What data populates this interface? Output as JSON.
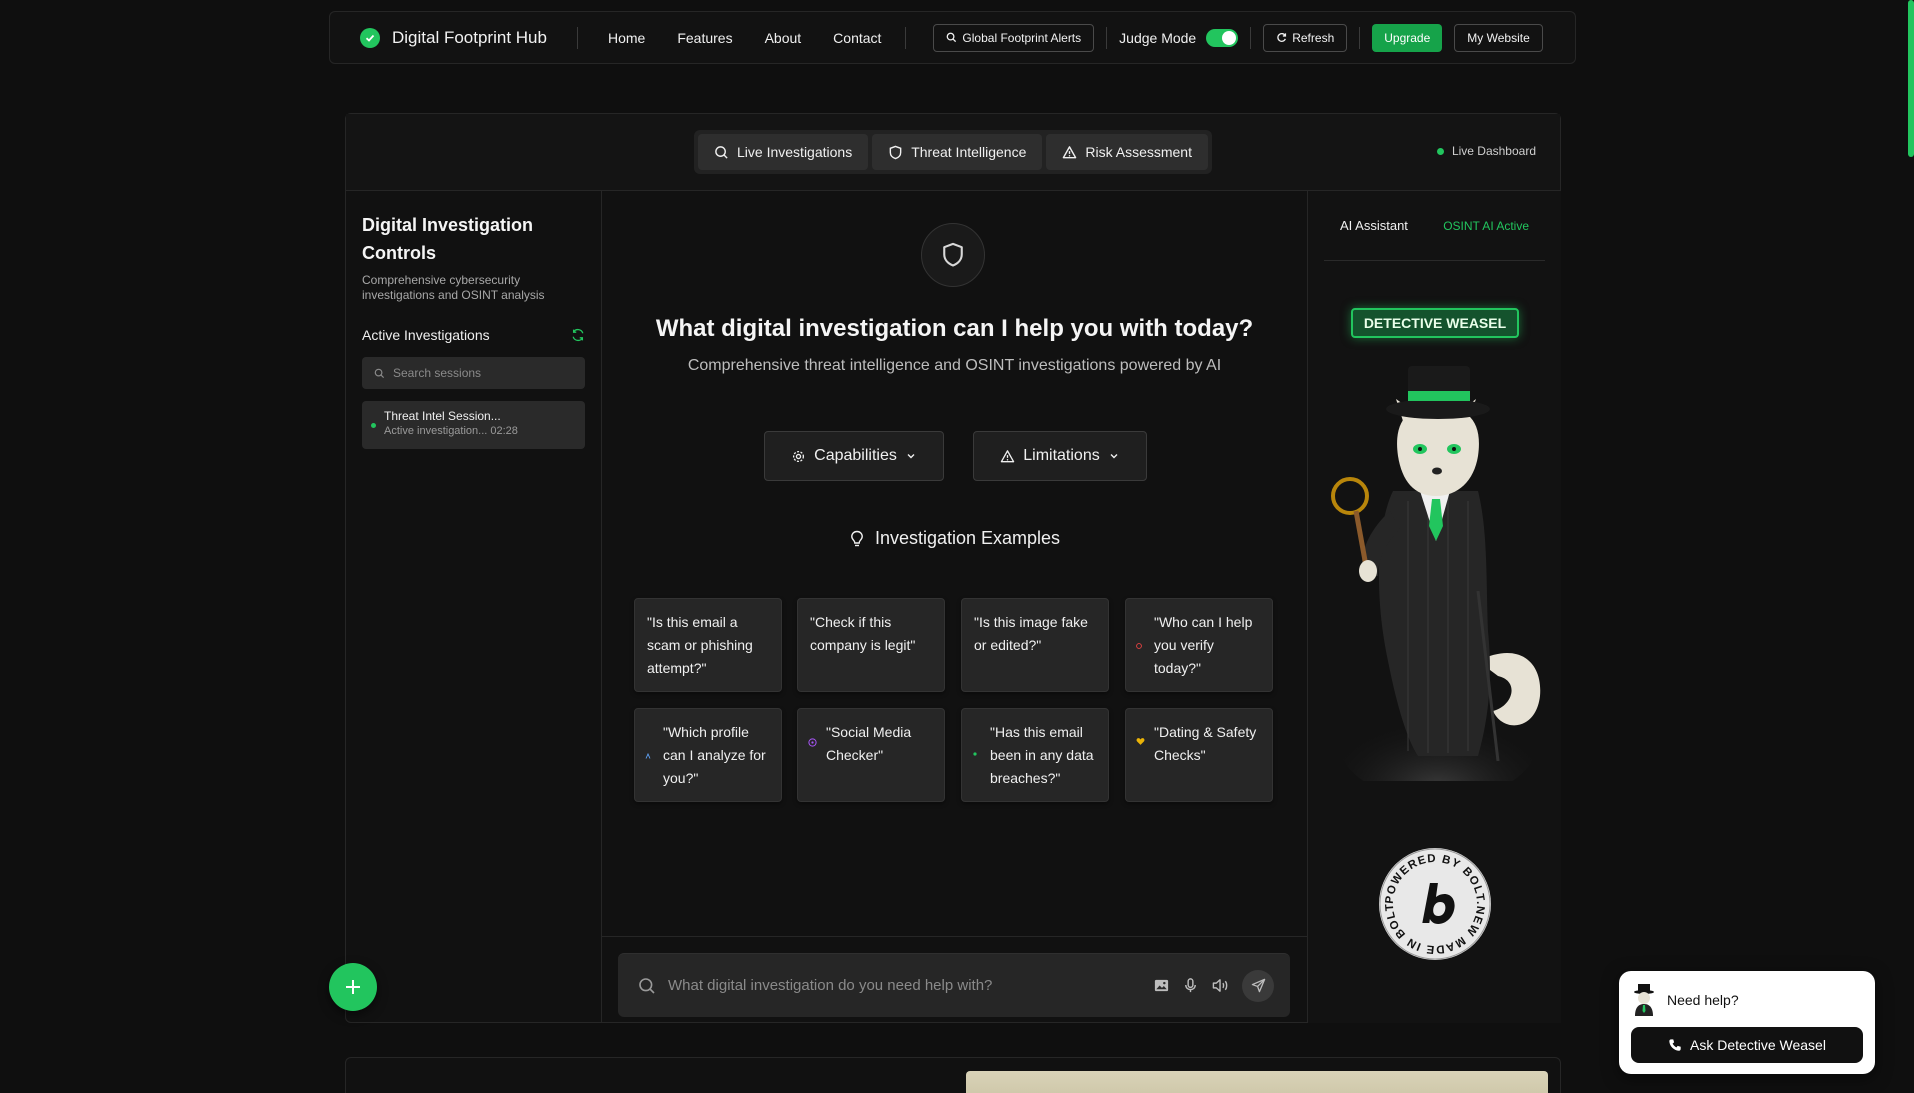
{
  "nav": {
    "brand": "Digital Footprint Hub",
    "links": [
      "Home",
      "Features",
      "About",
      "Contact"
    ],
    "alerts_label": "Global Footprint Alerts",
    "judge_label": "Judge Mode",
    "refresh_label": "Refresh",
    "upgrade_label": "Upgrade",
    "website_label": "My Website"
  },
  "tabs": [
    "Live Investigations",
    "Threat Intelligence",
    "Risk Assessment"
  ],
  "live_label": "Live Dashboard",
  "sidebar": {
    "title": "Digital Investigation Controls",
    "subtitle": "Comprehensive cybersecurity investigations and OSINT analysis",
    "active_label": "Active Investigations",
    "search_placeholder": "Search sessions",
    "session_title": "Threat Intel Session...",
    "session_status": "Active investigation... 02:28"
  },
  "main": {
    "headline": "What digital investigation can I help you with today?",
    "subline": "Comprehensive threat intelligence and OSINT investigations powered by AI",
    "capabilities_label": "Capabilities",
    "limitations_label": "Limitations",
    "examples_title": "Investigation Examples",
    "examples": [
      "\"Is this email a scam or phishing attempt?\"",
      "\"Check if this company is legit\"",
      "\"Is this image fake or edited?\"",
      "\"Who can I help you verify today?\"",
      "\"Which profile can I analyze for you?\"",
      "\"Social Media Checker\"",
      "\"Has this email been in any data breaches?\"",
      "\"Dating & Safety Checks\""
    ],
    "input_placeholder": "What digital investigation do you need help with?"
  },
  "assistant": {
    "title": "AI Assistant",
    "status": "OSINT AI Active",
    "badge": "DETECTIVE WEASEL",
    "bolt_text": "POWERED BY BOLT.NEW MADE IN BOLT.NEW"
  },
  "help": {
    "prompt": "Need help?",
    "button": "Ask Detective Weasel"
  },
  "colors": {
    "accent": "#22c55e",
    "background": "#0f0f0f",
    "panel": "#111111"
  }
}
